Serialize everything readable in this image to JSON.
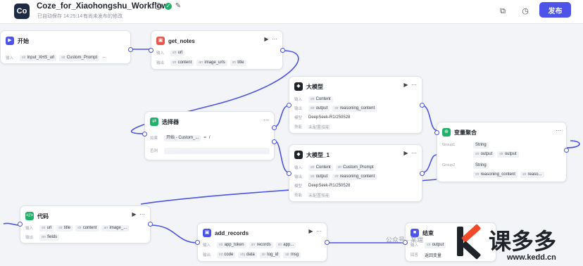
{
  "header": {
    "logo_text": "Co",
    "title": "Coze_for_Xiaohongshu_Workflow",
    "autosave": "已自动保存 14:25:14",
    "unpublished": "有尚未发布的修改",
    "publish_label": "发布"
  },
  "nodes": {
    "start": {
      "title": "开始",
      "l1": "输入",
      "params": [
        "input_XHS_url",
        "Custom_Prompt"
      ]
    },
    "get_notes": {
      "title": "get_notes",
      "l1": "输入",
      "input": "url",
      "l2": "输出",
      "outputs": [
        "content",
        "image_urls",
        "title"
      ]
    },
    "llm1": {
      "title": "大模型",
      "l1": "输入",
      "input": "Content",
      "l2": "输出",
      "outputs": [
        "output",
        "reasoning_content"
      ],
      "l3": "模型",
      "model": "DeepSeek-R1/250528",
      "l4": "技能",
      "skill": "未配置技能"
    },
    "selector": {
      "title": "选择器",
      "l1": "如果",
      "cond_source": "开始 - Custom_...",
      "cond_op": "=",
      "cond_val": "/",
      "l2": "否则"
    },
    "llm2": {
      "title": "大模型_1",
      "l1": "输入",
      "inputs": [
        "Content",
        "Custom_Prompt"
      ],
      "l2": "输出",
      "outputs": [
        "output",
        "reasoning_content"
      ],
      "l3": "模型",
      "model": "DeepSeek-R1/250528",
      "l4": "技能",
      "skill": "未配置技能"
    },
    "merge": {
      "title": "变量聚合",
      "g1": "Group1",
      "g1_type": "String",
      "g1_vars": [
        "output",
        "output"
      ],
      "g2": "Group2",
      "g2_type": "String",
      "g2_vars": [
        "reasoning_content",
        "reaso..."
      ]
    },
    "code": {
      "title": "代码",
      "l1": "输入",
      "inputs": [
        "url",
        "title",
        "content",
        "image_..."
      ],
      "l2": "输出",
      "outputs": [
        "fields"
      ]
    },
    "add_records": {
      "title": "add_records",
      "l1": "输入",
      "inputs": [
        "app_token",
        "records",
        "app..."
      ],
      "l2": "输出",
      "outputs": [
        "code",
        "data",
        "log_id",
        "msg"
      ]
    },
    "end": {
      "title": "结束",
      "l1": "输入",
      "input": "output",
      "l2": "回答",
      "answer": "返回变量"
    }
  },
  "watermark": {
    "brand": "课多多",
    "site": "www.kedd.cn",
    "account": "公众号 · 某端"
  },
  "colors": {
    "accent": "#4d53e8",
    "start": "#4d53e8",
    "plugin": "#e8574b",
    "llm": "#1f2329",
    "selector": "#1fb16a",
    "merge": "#1fb16a",
    "code": "#1fb16a",
    "end": "#4d53e8"
  }
}
